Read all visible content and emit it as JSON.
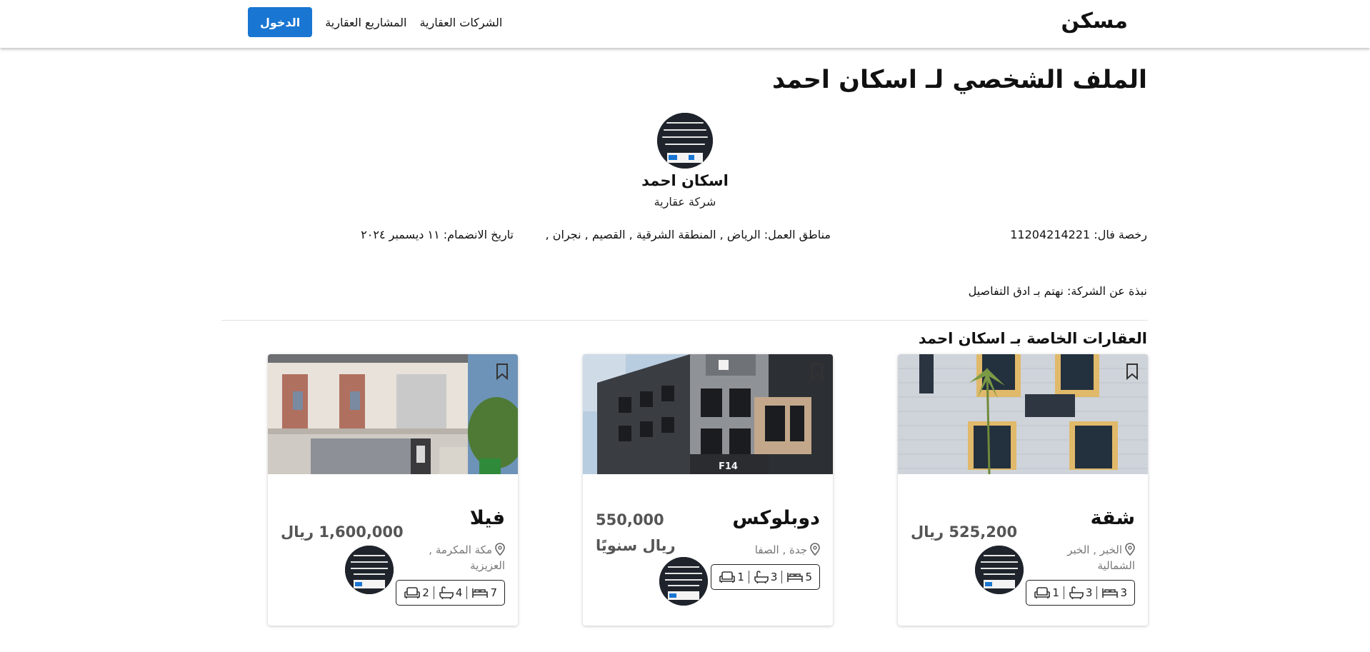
{
  "header": {
    "brand": "مسكن",
    "nav": [
      "الشركات العقارية",
      "المشاريع العقارية"
    ],
    "login_label": "الدخول",
    "login_color": "#1976d2"
  },
  "profile": {
    "page_title": "الملف الشخصي لـ اسكان احمد",
    "name": "اسكان احمد",
    "type": "شركة عقارية",
    "license": "رخصة فال: 11204214221",
    "regions": "مناطق العمل: الرياض , المنطقة الشرقية , القصيم , نجران ,",
    "joined": "تاريخ الانضمام: ١١ ديسمبر ٢٠٢٤",
    "about": "نبذة عن الشركة: نهتم بـ ادق التفاصيل"
  },
  "properties": {
    "section_title": "العقارات الخاصة بـ اسكان احمد",
    "cards": [
      {
        "type": "شقة",
        "price": "525,200 ريال",
        "location": "الخبر , الخبر الشمالية",
        "beds": "3",
        "baths": "3",
        "living": "1",
        "image": "apartment-building"
      },
      {
        "type": "دوبلوكس",
        "price": "550,000 ريال سنويًا",
        "location": "جدة , الصفا",
        "beds": "5",
        "baths": "3",
        "living": "1",
        "image": "duplex-building"
      },
      {
        "type": "فيلا",
        "price": "1,600,000 ريال",
        "location": "مكة المكرمة , العزيزية",
        "beds": "7",
        "baths": "4",
        "living": "2",
        "image": "villa"
      }
    ]
  },
  "icons": [
    "bookmark-icon",
    "location-pin-icon",
    "bed-icon",
    "bath-icon",
    "sofa-icon"
  ]
}
